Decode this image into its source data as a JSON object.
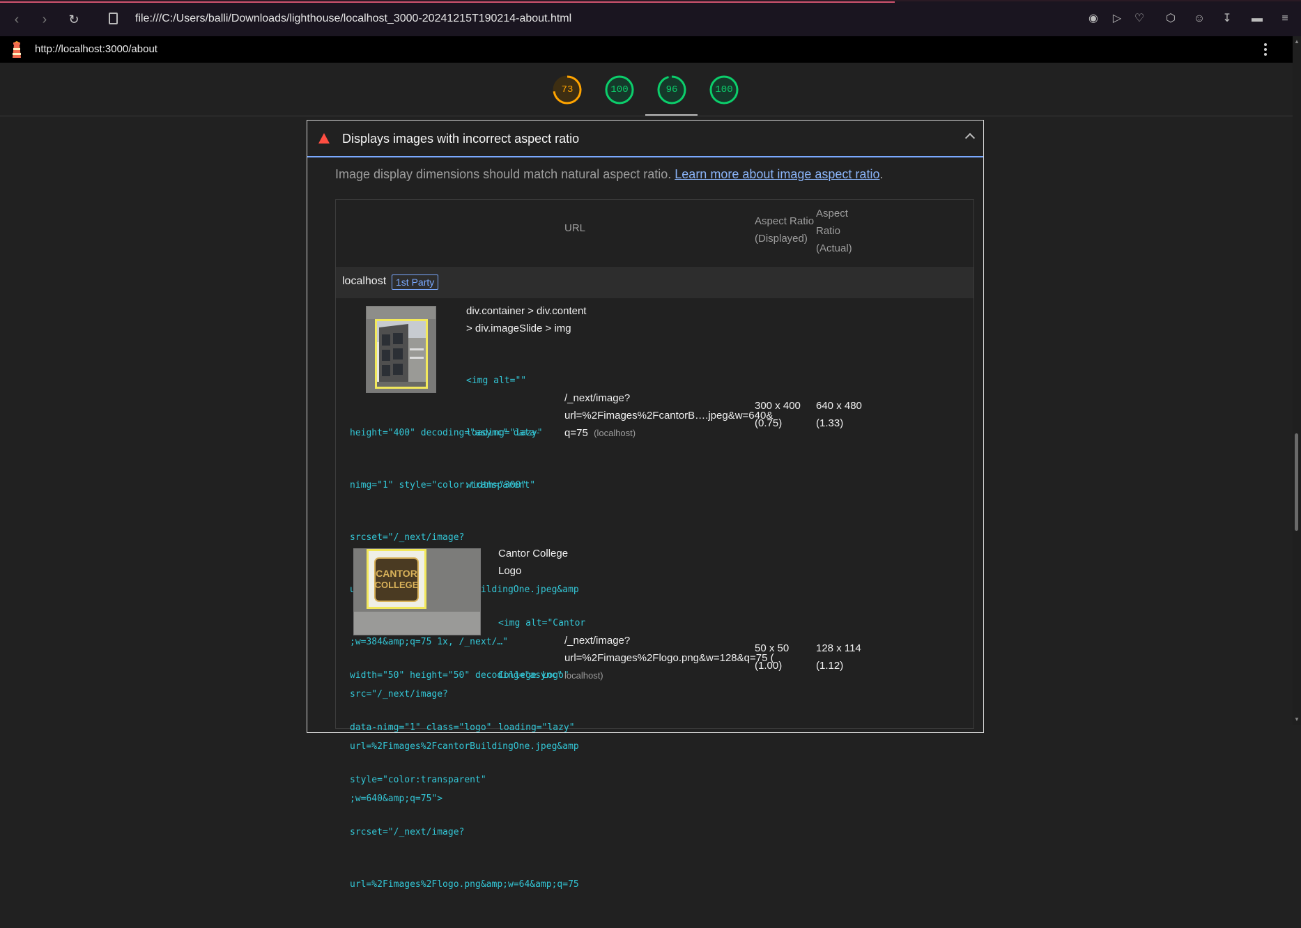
{
  "browser": {
    "address": "file:///C:/Users/balli/Downloads/lighthouse/localhost_3000-20241215T190214-about.html"
  },
  "lighthouse": {
    "page_url": "http://localhost:3000/about",
    "scores": [
      {
        "value": "73",
        "color": "#ffa400"
      },
      {
        "value": "100",
        "color": "#0cce6b"
      },
      {
        "value": "96",
        "color": "#0cce6b"
      },
      {
        "value": "100",
        "color": "#0cce6b"
      }
    ]
  },
  "audit": {
    "title": "Displays images with incorrect aspect ratio",
    "description": "Image display dimensions should match natural aspect ratio.",
    "link_text": "Learn more about image aspect ratio",
    "description_end": ".",
    "columns": {
      "url": "URL",
      "displayed": [
        "Aspect Ratio",
        "(Displayed)"
      ],
      "actual": [
        "Aspect",
        "Ratio",
        "(Actual)"
      ]
    },
    "group": {
      "name": "localhost",
      "badge": "1st Party"
    },
    "rows": [
      {
        "label_lines": [
          "div.container > div.content",
          "> div.imageSlide > img"
        ],
        "code_side": [
          "<img alt=\"\"",
          "loading=\"lazy\"",
          "width=\"300\""
        ],
        "code_full": [
          "height=\"400\" decoding=\"async\" data-",
          "nimg=\"1\" style=\"color:transparent\"",
          "srcset=\"/_next/image?",
          "url=%2Fimages%2FcantorBuildingOne.jpeg&amp",
          ";w=384&amp;q=75 1x, /_next/…\"",
          "src=\"/_next/image?",
          "url=%2Fimages%2FcantorBuildingOne.jpeg&amp",
          ";w=640&amp;q=75\">"
        ],
        "url_lines": [
          "/_next/image?",
          "url=%2Fimages%2FcantorB….jpeg&w=640&"
        ],
        "url_last": "q=75",
        "origin": "(localhost)",
        "displayed": [
          "300 x 400",
          "(0.75)"
        ],
        "actual": [
          "640 x 480",
          "(1.33)"
        ]
      },
      {
        "label_lines": [
          "Cantor College",
          "Logo"
        ],
        "code_side": [
          "<img alt=\"Cantor",
          "College Logo\"",
          "loading=\"lazy\""
        ],
        "code_full": [
          "width=\"50\" height=\"50\" decoding=\"async\"",
          "data-nimg=\"1\" class=\"logo\"",
          "style=\"color:transparent\"",
          "srcset=\"/_next/image?",
          "url=%2Fimages%2Flogo.png&amp;w=64&amp;q=75"
        ],
        "url_lines": [
          "/_next/image?",
          "url=%2Fimages%2Flogo.png&w=128&q=75 ("
        ],
        "url_last": "localhost)",
        "displayed": [
          "50 x 50",
          "(1.00)"
        ],
        "actual": [
          "128 x 114",
          "(1.12)"
        ],
        "logo_text": [
          "CANTOR",
          "COLLEGE"
        ]
      }
    ]
  }
}
